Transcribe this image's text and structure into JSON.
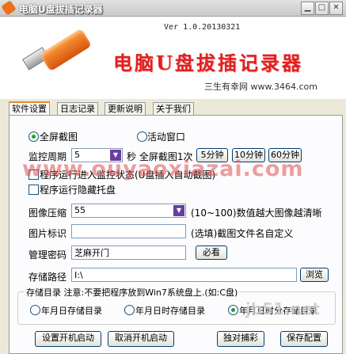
{
  "window": {
    "title": "电脑U盘拔插记录器"
  },
  "header": {
    "version": "Ver 1.0.20130321",
    "app_title": "电脑U盘拔插记录器",
    "subtitle": "三生有幸网 www.3464.com"
  },
  "tabs": [
    "软件设置",
    "日志记录",
    "更新说明",
    "关于我们"
  ],
  "capture": {
    "full_screen": "全屏截图",
    "active_window": "活动窗口"
  },
  "interval": {
    "label": "监控周期",
    "value": "5",
    "unit_text": "秒 全屏截图1次",
    "preset_5": "5分钟",
    "preset_10": "10分钟",
    "preset_60": "60分钟"
  },
  "options": {
    "monitor_on_run": "程序运行进入监控状态(U盘插入自动截图)",
    "hide_tray": "程序运行隐藏托盘"
  },
  "compression": {
    "label": "图像压缩",
    "value": "55",
    "hint": "(10~100)数值越大图像越清晰"
  },
  "image_tag": {
    "label": "图片标识",
    "value": "",
    "hint": "(选填)截图文件名自定义"
  },
  "password": {
    "label": "管理密码",
    "value": "芝麻开门",
    "button": "必看"
  },
  "storage": {
    "label": "存储路径",
    "value": "I:\\",
    "browse": "浏览"
  },
  "directory": {
    "group_label": "存储目录 注意:不要把程序放到Win7系统盘上.(如:C盘)",
    "opt1": "年月日存储目录",
    "opt2": "年月日时存储目录",
    "opt3": "年月日时分存储目录"
  },
  "footer": {
    "set_startup": "设置开机启动",
    "cancel_startup": "取消开机启动",
    "exclusive": "独对捕彩",
    "save": "保存配置"
  },
  "watermarks": {
    "mid": "www.ouyaoxiazai.com",
    "corner": "jb51.net"
  }
}
